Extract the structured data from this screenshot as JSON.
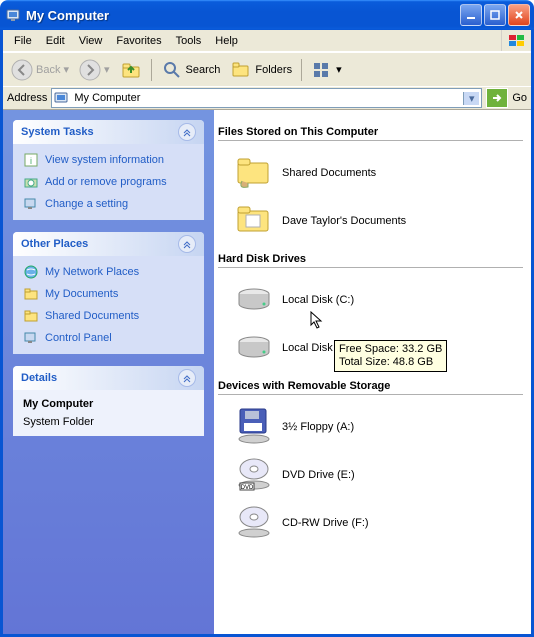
{
  "window": {
    "title": "My Computer"
  },
  "menubar": [
    "File",
    "Edit",
    "View",
    "Favorites",
    "Tools",
    "Help"
  ],
  "toolbar": {
    "back_label": "Back",
    "search_label": "Search",
    "folders_label": "Folders"
  },
  "addressbar": {
    "label": "Address",
    "value": "My Computer",
    "go_label": "Go"
  },
  "sidebar": {
    "system_tasks": {
      "title": "System Tasks",
      "items": [
        "View system information",
        "Add or remove programs",
        "Change a setting"
      ]
    },
    "other_places": {
      "title": "Other Places",
      "items": [
        "My Network Places",
        "My Documents",
        "Shared Documents",
        "Control Panel"
      ]
    },
    "details": {
      "title": "Details",
      "name": "My Computer",
      "type": "System Folder"
    }
  },
  "groups": [
    {
      "header": "Files Stored on This Computer",
      "items": [
        {
          "label": "Shared Documents",
          "icon": "folder-hand"
        },
        {
          "label": "Dave Taylor's Documents",
          "icon": "folder"
        }
      ]
    },
    {
      "header": "Hard Disk Drives",
      "items": [
        {
          "label": "Local Disk (C:)",
          "icon": "hdd"
        },
        {
          "label": "Local Disk (D:)",
          "icon": "hdd"
        }
      ]
    },
    {
      "header": "Devices with Removable Storage",
      "items": [
        {
          "label": "3½ Floppy (A:)",
          "icon": "floppy"
        },
        {
          "label": "DVD Drive (E:)",
          "icon": "dvd"
        },
        {
          "label": "CD-RW Drive (F:)",
          "icon": "cd"
        }
      ]
    }
  ],
  "tooltip": {
    "line1": "Free Space: 33.2 GB",
    "line2": "Total Size: 48.8 GB"
  }
}
